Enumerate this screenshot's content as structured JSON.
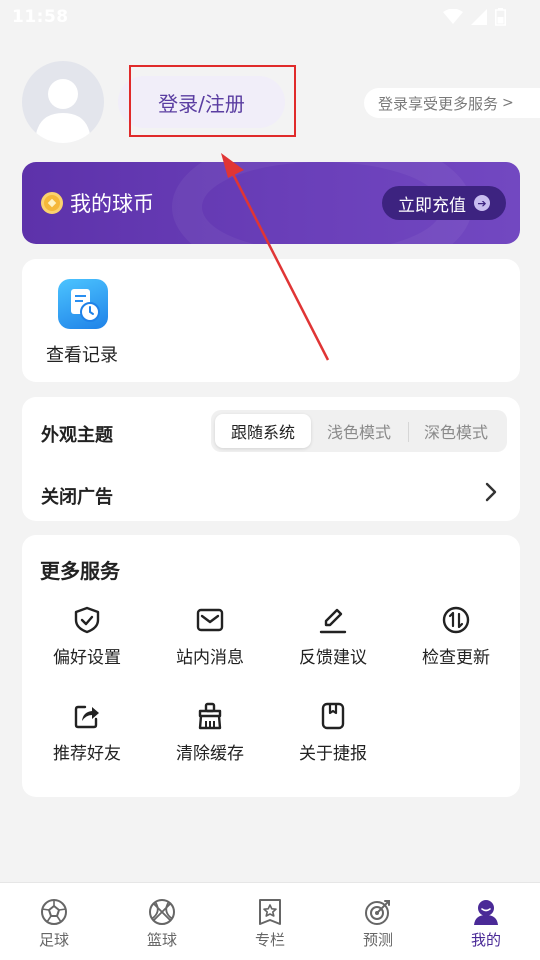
{
  "status_bar": {
    "time": "11:58"
  },
  "header": {
    "login_label": "登录/注册",
    "promo_label": "登录享受更多服务",
    "promo_chevron": ">"
  },
  "coin_banner": {
    "title": "我的球币",
    "button_label": "立即充值",
    "accent": "#6a3fb9"
  },
  "history": {
    "label": "查看记录"
  },
  "settings": {
    "theme_label": "外观主题",
    "theme_options": [
      "跟随系统",
      "浅色模式",
      "深色模式"
    ],
    "theme_selected": "跟随系统",
    "ads_label": "关闭广告"
  },
  "services": {
    "title": "更多服务",
    "items": [
      {
        "label": "偏好设置",
        "icon": "shield-check-icon"
      },
      {
        "label": "站内消息",
        "icon": "mail-icon"
      },
      {
        "label": "反馈建议",
        "icon": "edit-icon"
      },
      {
        "label": "检查更新",
        "icon": "update-arrows-icon"
      },
      {
        "label": "推荐好友",
        "icon": "share-icon"
      },
      {
        "label": "清除缓存",
        "icon": "broom-icon"
      },
      {
        "label": "关于捷报",
        "icon": "bookmark-icon"
      }
    ]
  },
  "bottom_nav": {
    "items": [
      {
        "label": "足球",
        "icon": "soccer-ball-icon"
      },
      {
        "label": "篮球",
        "icon": "basketball-icon"
      },
      {
        "label": "专栏",
        "icon": "star-doc-icon"
      },
      {
        "label": "预测",
        "icon": "target-icon"
      },
      {
        "label": "我的",
        "icon": "profile-icon"
      }
    ],
    "active": "我的",
    "active_color": "#4a2a97"
  }
}
